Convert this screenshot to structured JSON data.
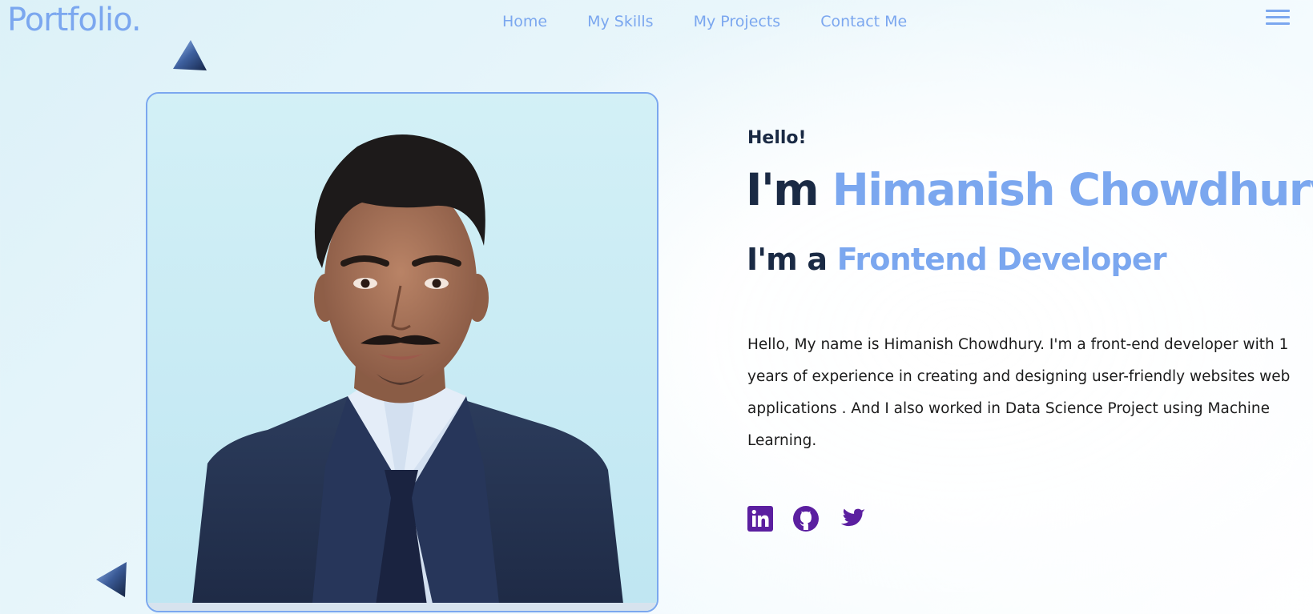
{
  "header": {
    "logo": "Portfolio.",
    "nav": [
      "Home",
      "My Skills",
      "My Projects",
      "Contact Me"
    ],
    "menu_icon": "hamburger-menu-icon"
  },
  "hero": {
    "greeting": "Hello!",
    "name_prefix": "I'm",
    "name": "Himanish Chowdhury",
    "role_prefix": "I'm a",
    "role": "Frontend Developer",
    "bio": "Hello, My name is Himanish Chowdhury. I'm a front-end developer with 1 years of experience in creating and designing user-friendly websites web applications . And I also worked in Data Science Project using Machine Learning.",
    "photo": "profile-photo"
  },
  "socials": [
    {
      "icon": "linkedin-icon"
    },
    {
      "icon": "github-icon"
    },
    {
      "icon": "twitter-icon"
    }
  ],
  "colors": {
    "accent": "#7ba7ef",
    "heading": "#1a2a44",
    "social": "#5b1fa0",
    "background": "#e6f5fa"
  }
}
